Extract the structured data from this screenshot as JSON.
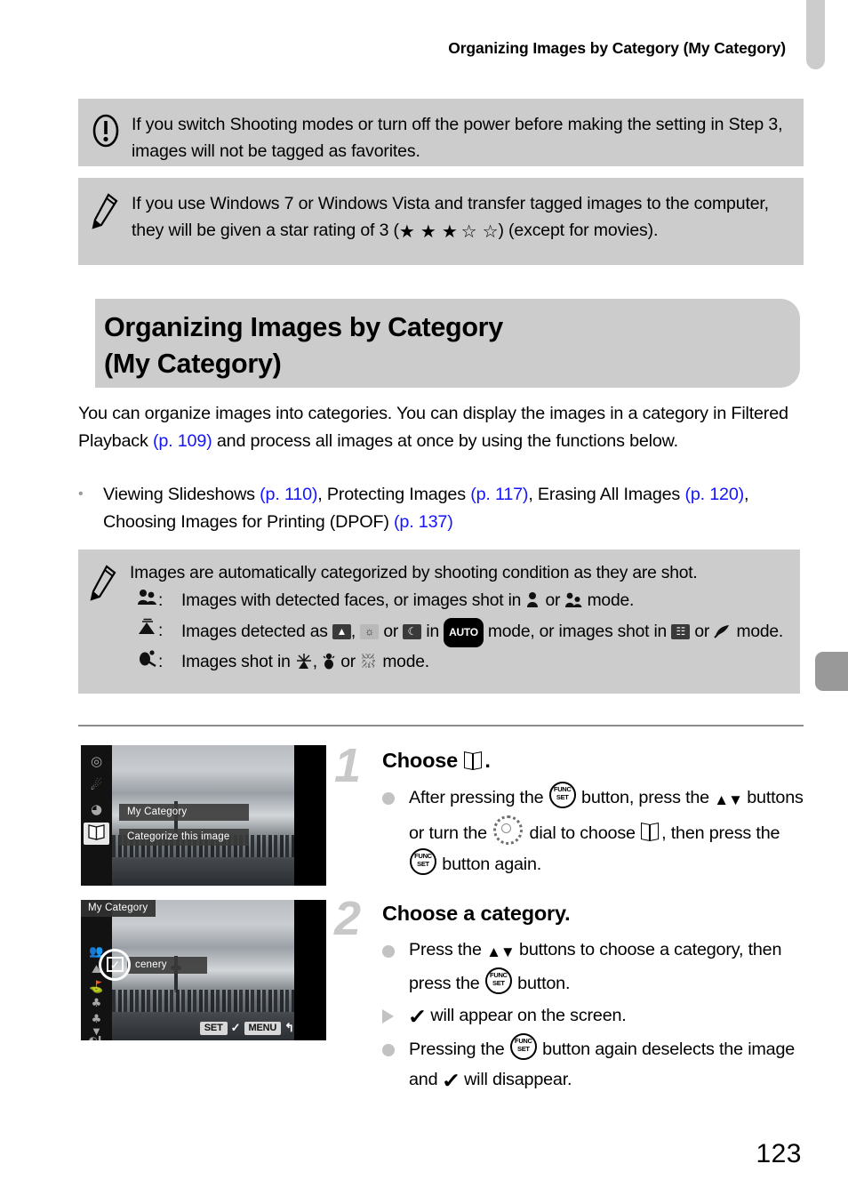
{
  "header": {
    "running_title": "Organizing Images by Category (My Category)"
  },
  "callouts": [
    {
      "icon": "exclamation-circle-icon",
      "text": "If you switch Shooting modes or turn off the power before making the setting in Step 3, images will not be tagged as favorites."
    },
    {
      "icon": "pencil-note-icon",
      "text_before": "If you use Windows 7 or Windows Vista and transfer tagged images to the computer, they will be given a star rating of 3 (",
      "stars_filled": "★ ★ ★",
      "stars_empty": "☆ ☆",
      "text_after": ") (except for movies)."
    }
  ],
  "section": {
    "title_line1": "Organizing Images by Category",
    "title_line2": "(My Category)"
  },
  "intro": {
    "part1": "You can organize images into categories. You can display the images in a category in Filtered Playback ",
    "ref1": "(p. 109)",
    "part2": " and process all images at once by using the functions below."
  },
  "bullet": {
    "marker": "•",
    "p1": "Viewing Slideshows ",
    "ref1": "(p. 110)",
    "p2": ", Protecting Images ",
    "ref2": "(p. 117)",
    "p3": ", Erasing All Images ",
    "ref3": "(p. 120)",
    "p4": ", Choosing Images for Printing (DPOF) ",
    "ref4": "(p. 137)"
  },
  "note": {
    "icon": "pencil-note-icon",
    "intro": "Images are automatically categorized by shooting condition as they are shot.",
    "rows": [
      {
        "key_icon": "people-category-icon",
        "separator": ":",
        "t1": "Images with detected faces, or images shot in ",
        "icon1": "portrait-mode-icon",
        "t2": " or ",
        "icon2": "kids-and-pets-mode-icon",
        "t3": " mode."
      },
      {
        "key_icon": "scenery-category-icon",
        "separator": ":",
        "t1": "Images detected as ",
        "icon1": "landscape-detect-icon",
        "t2": ", ",
        "icon2": "sunset-detect-icon",
        "t3": " or ",
        "icon3": "night-detect-icon",
        "t4": " in ",
        "badge": "AUTO",
        "t5": " mode, or images shot in ",
        "icon4": "long-shutter-mode-icon",
        "t6": " or ",
        "icon5": "foliage-mode-icon",
        "t7": " mode."
      },
      {
        "key_icon": "events-category-icon",
        "separator": ":",
        "t1": "Images shot in ",
        "icon1": "fireworks-mode-icon",
        "t2": ", ",
        "icon2": "beach-mode-icon",
        "t3": " or ",
        "icon3": "snow-mode-icon",
        "t4": " mode."
      }
    ]
  },
  "steps": [
    {
      "number": "1",
      "title_prefix": "Choose ",
      "title_icon": "my-category-book-icon",
      "title_suffix": ".",
      "items": [
        {
          "marker": "dot",
          "t1": "After pressing the ",
          "btn1": "FUNC.SET",
          "t2": " button, press the ",
          "arrows": "▲▼",
          "t3": " buttons or turn the ",
          "dial": "control-dial-icon",
          "t4": " dial to choose ",
          "icon2": "my-category-book-icon",
          "t5": ", then press the ",
          "btn2": "FUNC.SET",
          "t6": " button again."
        }
      ]
    },
    {
      "number": "2",
      "title_prefix": "Choose a category.",
      "items": [
        {
          "marker": "dot",
          "t1": "Press the ",
          "arrows": "▲▼",
          "t2": " buttons to choose a category, then press the ",
          "btn1": "FUNC.SET",
          "t3": " button."
        },
        {
          "marker": "triangle",
          "check": "✓",
          "t1": " will appear on the screen."
        },
        {
          "marker": "dot",
          "t1": "Pressing the ",
          "btn1": "FUNC.SET",
          "t2": " button again deselects the image and ",
          "check": "✓",
          "t3": " will disappear."
        }
      ]
    }
  ],
  "camera_screens": [
    {
      "name": "func-menu-screen",
      "menu_title": "My Category",
      "menu_subtitle": "Categorize this image",
      "sidebar_icons": [
        "metering-icon",
        "white-balance-icon",
        "red-eye-correction-icon",
        "my-category-book-icon"
      ],
      "selected_sidebar_index": 3
    },
    {
      "name": "my-category-select-screen",
      "title": "My Category",
      "category_label": "cenery",
      "checkbox_mark": "✓",
      "sidebar_icons": [
        "people-category-icon",
        "scenery-category-icon",
        "events-category-icon",
        "category1-icon",
        "category2-icon",
        "more-down-icon",
        "image-quality-L-icon"
      ],
      "bottom_keys": {
        "set": "SET",
        "check": "✓",
        "menu": "MENU",
        "back": "↰"
      }
    }
  ],
  "footer": {
    "page_number": "123"
  },
  "colors": {
    "callout_bg": "#cccccc",
    "link": "#1414ff",
    "step_number": "#c8c8c8",
    "tab_light": "#cccccc",
    "tab_dark": "#999999"
  }
}
